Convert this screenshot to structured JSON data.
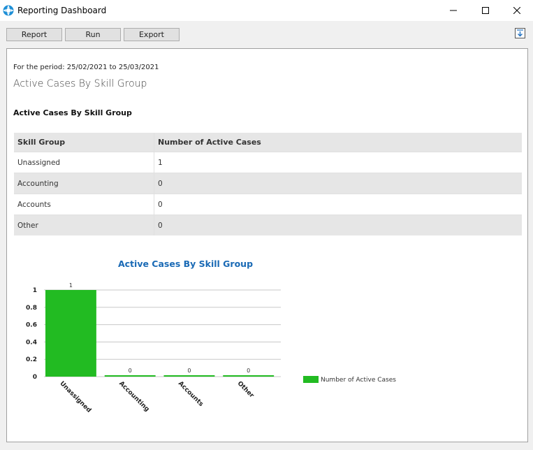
{
  "window": {
    "title": "Reporting Dashboard"
  },
  "toolbar": {
    "report_label": "Report",
    "run_label": "Run",
    "export_label": "Export"
  },
  "report": {
    "period": "For the period: 25/02/2021 to 25/03/2021",
    "title": "Active Cases By Skill Group",
    "section_title": "Active Cases By Skill Group",
    "table": {
      "headers": [
        "Skill Group",
        "Number of Active Cases"
      ],
      "rows": [
        [
          "Unassigned",
          "1"
        ],
        [
          "Accounting",
          "0"
        ],
        [
          "Accounts",
          "0"
        ],
        [
          "Other",
          "0"
        ]
      ]
    }
  },
  "colors": {
    "bar": "#22bb22",
    "chart_title": "#1a6ab5",
    "header_bg": "#e6e6e6"
  },
  "chart_data": {
    "type": "bar",
    "title": "Active Cases By Skill Group",
    "categories": [
      "Unassigned",
      "Accounting",
      "Accounts",
      "Other"
    ],
    "series": [
      {
        "name": "Number of Active Cases",
        "values": [
          1,
          0,
          0,
          0
        ]
      }
    ],
    "ylim": [
      0,
      1
    ],
    "yticks": [
      "0",
      "0.2",
      "0.4",
      "0.6",
      "0.8",
      "1"
    ],
    "grid": true,
    "legend": "right"
  }
}
